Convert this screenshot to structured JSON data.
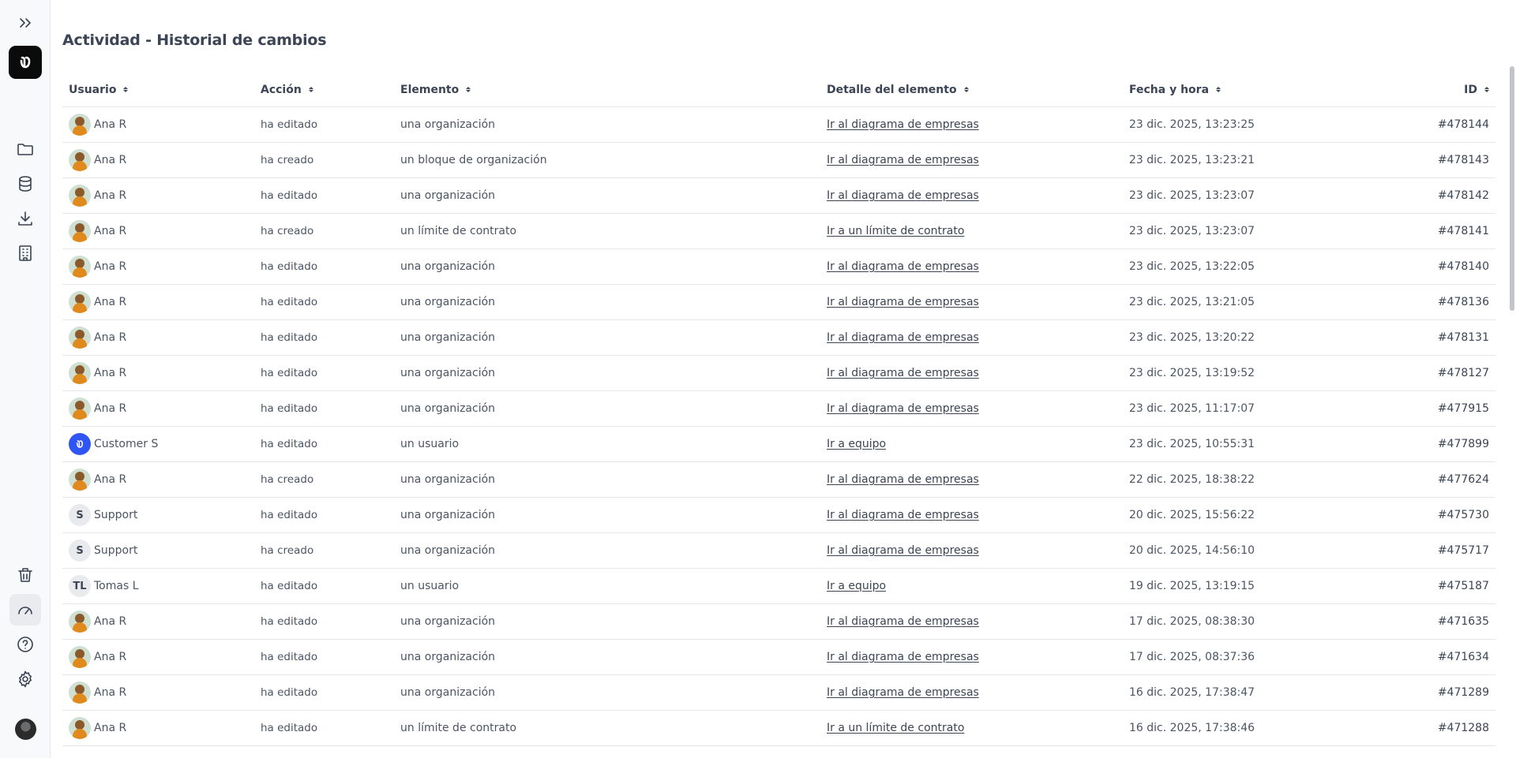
{
  "page": {
    "title": "Actividad - Historial de cambios"
  },
  "columns": {
    "user": "Usuario",
    "action": "Acción",
    "element": "Elemento",
    "detail": "Detalle del elemento",
    "datetime": "Fecha y hora",
    "id": "ID"
  },
  "rows": [
    {
      "user": "Ana R",
      "avatar": "photo",
      "action": "ha editado",
      "element": "una organización",
      "detail": "Ir al diagrama de empresas",
      "datetime": "23 dic. 2025, 13:23:25",
      "id": "#478144"
    },
    {
      "user": "Ana R",
      "avatar": "photo",
      "action": "ha creado",
      "element": "un bloque de organización",
      "detail": "Ir al diagrama de empresas",
      "datetime": "23 dic. 2025, 13:23:21",
      "id": "#478143"
    },
    {
      "user": "Ana R",
      "avatar": "photo",
      "action": "ha editado",
      "element": "una organización",
      "detail": "Ir al diagrama de empresas",
      "datetime": "23 dic. 2025, 13:23:07",
      "id": "#478142"
    },
    {
      "user": "Ana R",
      "avatar": "photo",
      "action": "ha creado",
      "element": "un límite de contrato",
      "detail": "Ir a un límite de contrato",
      "datetime": "23 dic. 2025, 13:23:07",
      "id": "#478141"
    },
    {
      "user": "Ana R",
      "avatar": "photo",
      "action": "ha editado",
      "element": "una organización",
      "detail": "Ir al diagrama de empresas",
      "datetime": "23 dic. 2025, 13:22:05",
      "id": "#478140"
    },
    {
      "user": "Ana R",
      "avatar": "photo",
      "action": "ha editado",
      "element": "una organización",
      "detail": "Ir al diagrama de empresas",
      "datetime": "23 dic. 2025, 13:21:05",
      "id": "#478136"
    },
    {
      "user": "Ana R",
      "avatar": "photo",
      "action": "ha editado",
      "element": "una organización",
      "detail": "Ir al diagrama de empresas",
      "datetime": "23 dic. 2025, 13:20:22",
      "id": "#478131"
    },
    {
      "user": "Ana R",
      "avatar": "photo",
      "action": "ha editado",
      "element": "una organización",
      "detail": "Ir al diagrama de empresas",
      "datetime": "23 dic. 2025, 13:19:52",
      "id": "#478127"
    },
    {
      "user": "Ana R",
      "avatar": "photo",
      "action": "ha editado",
      "element": "una organización",
      "detail": "Ir al diagrama de empresas",
      "datetime": "23 dic. 2025, 11:17:07",
      "id": "#477915"
    },
    {
      "user": "Customer S",
      "avatar": "brand",
      "action": "ha editado",
      "element": "un usuario",
      "detail": "Ir a equipo",
      "datetime": "23 dic. 2025, 10:55:31",
      "id": "#477899"
    },
    {
      "user": "Ana R",
      "avatar": "photo",
      "action": "ha creado",
      "element": "una organización",
      "detail": "Ir al diagrama de empresas",
      "datetime": "22 dic. 2025, 18:38:22",
      "id": "#477624"
    },
    {
      "user": "Support",
      "avatar": "S",
      "action": "ha editado",
      "element": "una organización",
      "detail": "Ir al diagrama de empresas",
      "datetime": "20 dic. 2025, 15:56:22",
      "id": "#475730"
    },
    {
      "user": "Support",
      "avatar": "S",
      "action": "ha creado",
      "element": "una organización",
      "detail": "Ir al diagrama de empresas",
      "datetime": "20 dic. 2025, 14:56:10",
      "id": "#475717"
    },
    {
      "user": "Tomas L",
      "avatar": "TL",
      "action": "ha editado",
      "element": "un usuario",
      "detail": "Ir a equipo",
      "datetime": "19 dic. 2025, 13:19:15",
      "id": "#475187"
    },
    {
      "user": "Ana R",
      "avatar": "photo",
      "action": "ha editado",
      "element": "una organización",
      "detail": "Ir al diagrama de empresas",
      "datetime": "17 dic. 2025, 08:38:30",
      "id": "#471635"
    },
    {
      "user": "Ana R",
      "avatar": "photo",
      "action": "ha editado",
      "element": "una organización",
      "detail": "Ir al diagrama de empresas",
      "datetime": "17 dic. 2025, 08:37:36",
      "id": "#471634"
    },
    {
      "user": "Ana R",
      "avatar": "photo",
      "action": "ha editado",
      "element": "una organización",
      "detail": "Ir al diagrama de empresas",
      "datetime": "16 dic. 2025, 17:38:47",
      "id": "#471289"
    },
    {
      "user": "Ana R",
      "avatar": "photo",
      "action": "ha editado",
      "element": "un límite de contrato",
      "detail": "Ir a un límite de contrato",
      "datetime": "16 dic. 2025, 17:38:46",
      "id": "#471288"
    }
  ],
  "icons": {
    "expand": "chevrons-right-icon",
    "logo": "brand-logo-icon",
    "folder": "folder-icon",
    "database": "database-icon",
    "download": "download-icon",
    "building": "building-icon",
    "trash": "trash-icon",
    "gauge": "gauge-icon",
    "help": "help-circle-icon",
    "settings": "gear-icon"
  },
  "colors": {
    "brand": "#2f55f5",
    "sidebar_bg": "#f8f9fa",
    "text": "#3c4555"
  }
}
